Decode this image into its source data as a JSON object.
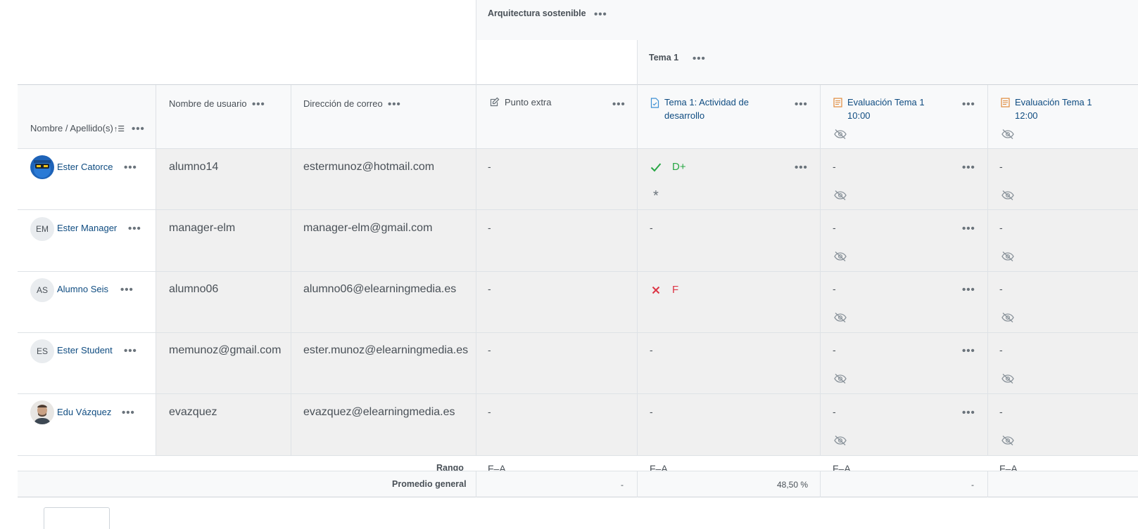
{
  "categories": {
    "course": "Arquitectura sostenible",
    "topic": "Tema 1"
  },
  "headers": {
    "name": "Nombre / Apellido(s)",
    "username": "Nombre de usuario",
    "email": "Dirección de correo",
    "extra": "Punto extra",
    "activity": "Tema 1: Actividad de desarrollo",
    "eval1000": "Evaluación Tema 1 10:00",
    "eval1200": "Evaluación Tema 1 12:00"
  },
  "students": [
    {
      "name": "Ester Catorce",
      "initials": "",
      "username": "alumno14",
      "email": "estermunoz@hotmail.com",
      "extra": "-",
      "activity": "D+",
      "activity_status": "pass",
      "activity_note": "*",
      "eval1000": "-",
      "eval1200": "-"
    },
    {
      "name": "Ester Manager",
      "initials": "EM",
      "username": "manager-elm",
      "email": "manager-elm@gmail.com",
      "extra": "-",
      "activity": "-",
      "activity_status": "none",
      "activity_note": "",
      "eval1000": "-",
      "eval1200": "-"
    },
    {
      "name": "Alumno Seis",
      "initials": "AS",
      "username": "alumno06",
      "email": "alumno06@elearningmedia.es",
      "extra": "-",
      "activity": "F",
      "activity_status": "fail",
      "activity_note": "",
      "eval1000": "-",
      "eval1200": "-"
    },
    {
      "name": "Ester Student",
      "initials": "ES",
      "username": "memunoz@gmail.com",
      "email": "ester.munoz@elearningmedia.es",
      "extra": "-",
      "activity": "-",
      "activity_status": "none",
      "activity_note": "",
      "eval1000": "-",
      "eval1200": "-"
    },
    {
      "name": "Edu Vázquez",
      "initials": "",
      "username": "evazquez",
      "email": "evazquez@elearningmedia.es",
      "extra": "-",
      "activity": "-",
      "activity_status": "none",
      "activity_note": "",
      "eval1000": "-",
      "eval1200": "-"
    }
  ],
  "footer": {
    "range_label": "Rango",
    "range_extra": "F–A",
    "range_activity": "F–A",
    "range_eval1000": "F–A",
    "range_eval1200": "F–A",
    "average_label": "Promedio general",
    "avg_extra": "-",
    "avg_activity": "48,50 %",
    "avg_eval1000": "-"
  },
  "icons": {
    "more": "more-dots-icon",
    "sort": "sort-asc-icon",
    "edit": "edit-icon",
    "assignment": "assignment-icon",
    "quiz": "quiz-icon",
    "hidden": "eye-slash-icon",
    "pass": "check-icon",
    "fail": "cross-icon"
  },
  "colors": {
    "link": "#0f4c81",
    "pass": "#28a745",
    "fail": "#dc3545"
  }
}
